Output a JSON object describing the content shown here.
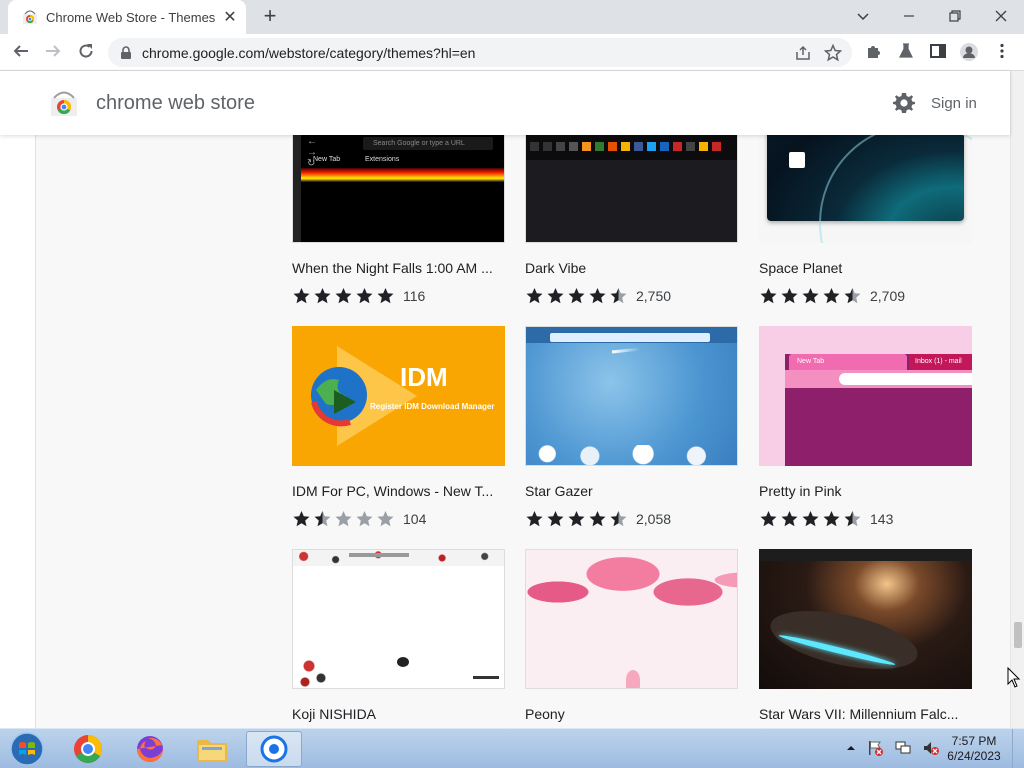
{
  "browser": {
    "tab_title": "Chrome Web Store - Themes",
    "tab_close": "✕",
    "new_tab": "+",
    "url": "chrome.google.com/webstore/category/themes?hl=en"
  },
  "store": {
    "name": "chrome web store",
    "sign_in": "Sign in"
  },
  "themes": [
    {
      "title": "When the Night Falls 1:00 AM ...",
      "count": "116",
      "rating": 5
    },
    {
      "title": "Dark Vibe",
      "count": "2,750",
      "rating": 4.5
    },
    {
      "title": "Space Planet",
      "count": "2,709",
      "rating": 4.5
    },
    {
      "title": "IDM For PC, Windows - New T...",
      "count": "104",
      "rating": 1.5
    },
    {
      "title": "Star Gazer",
      "count": "2,058",
      "rating": 4.5
    },
    {
      "title": "Pretty in Pink",
      "count": "143",
      "rating": 4.5
    },
    {
      "title": "Koji NISHIDA",
      "count": "",
      "rating": 0
    },
    {
      "title": "Peony",
      "count": "",
      "rating": 0
    },
    {
      "title": "Star Wars VII: Millennium Falc...",
      "count": "",
      "rating": 0
    }
  ],
  "thumb_text": {
    "night_search": "Search Google or type a URL",
    "night_newtab": "New Tab",
    "night_ext": "Extensions",
    "idm_big": "IDM",
    "idm_small": "Register IDM Download Manager",
    "pink_tab1": "New Tab",
    "pink_tab2": "Inbox (1) - mail"
  },
  "taskbar": {
    "time": "7:57 PM",
    "date": "6/24/2023"
  },
  "colors": {
    "star_filled": "#202124",
    "star_empty": "#9aa0a6",
    "idm_bg": "#f9a602",
    "pink_bg": "#8e1f6b"
  }
}
